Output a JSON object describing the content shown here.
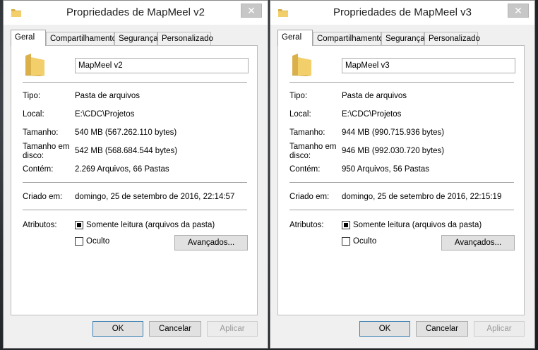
{
  "windows": [
    {
      "title": "Propriedades de MapMeel v2",
      "tabs": [
        "Geral",
        "Compartilhamento",
        "Segurança",
        "Personalizado"
      ],
      "name_value": "MapMeel v2",
      "rows": {
        "tipo_label": "Tipo:",
        "tipo_value": "Pasta de arquivos",
        "local_label": "Local:",
        "local_value": "E:\\CDC\\Projetos",
        "tamanho_label": "Tamanho:",
        "tamanho_value": "540 MB (567.262.110 bytes)",
        "disco_label": "Tamanho em disco:",
        "disco_value": "542 MB (568.684.544 bytes)",
        "contem_label": "Contém:",
        "contem_value": "2.269 Arquivos, 66 Pastas",
        "criado_label": "Criado em:",
        "criado_value": "domingo, 25 de setembro de 2016, 22:14:57",
        "atributos_label": "Atributos:"
      },
      "attributes": {
        "readonly_label": "Somente leitura (arquivos da pasta)",
        "hidden_label": "Oculto",
        "advanced_label": "Avançados..."
      },
      "buttons": {
        "ok": "OK",
        "cancel": "Cancelar",
        "apply": "Aplicar"
      },
      "close_glyph": "✕"
    },
    {
      "title": "Propriedades de MapMeel v3",
      "tabs": [
        "Geral",
        "Compartilhamento",
        "Segurança",
        "Personalizado"
      ],
      "name_value": "MapMeel v3",
      "rows": {
        "tipo_label": "Tipo:",
        "tipo_value": "Pasta de arquivos",
        "local_label": "Local:",
        "local_value": "E:\\CDC\\Projetos",
        "tamanho_label": "Tamanho:",
        "tamanho_value": "944 MB (990.715.936 bytes)",
        "disco_label": "Tamanho em disco:",
        "disco_value": "946 MB (992.030.720 bytes)",
        "contem_label": "Contém:",
        "contem_value": "950 Arquivos, 56 Pastas",
        "criado_label": "Criado em:",
        "criado_value": "domingo, 25 de setembro de 2016, 22:15:19",
        "atributos_label": "Atributos:"
      },
      "attributes": {
        "readonly_label": "Somente leitura (arquivos da pasta)",
        "hidden_label": "Oculto",
        "advanced_label": "Avançados..."
      },
      "buttons": {
        "ok": "OK",
        "cancel": "Cancelar",
        "apply": "Aplicar"
      },
      "close_glyph": "✕"
    }
  ],
  "colors": {
    "folder": "#f2cf6b",
    "folder_dark": "#d9b04a",
    "close_bg": "#c7c7c7"
  }
}
